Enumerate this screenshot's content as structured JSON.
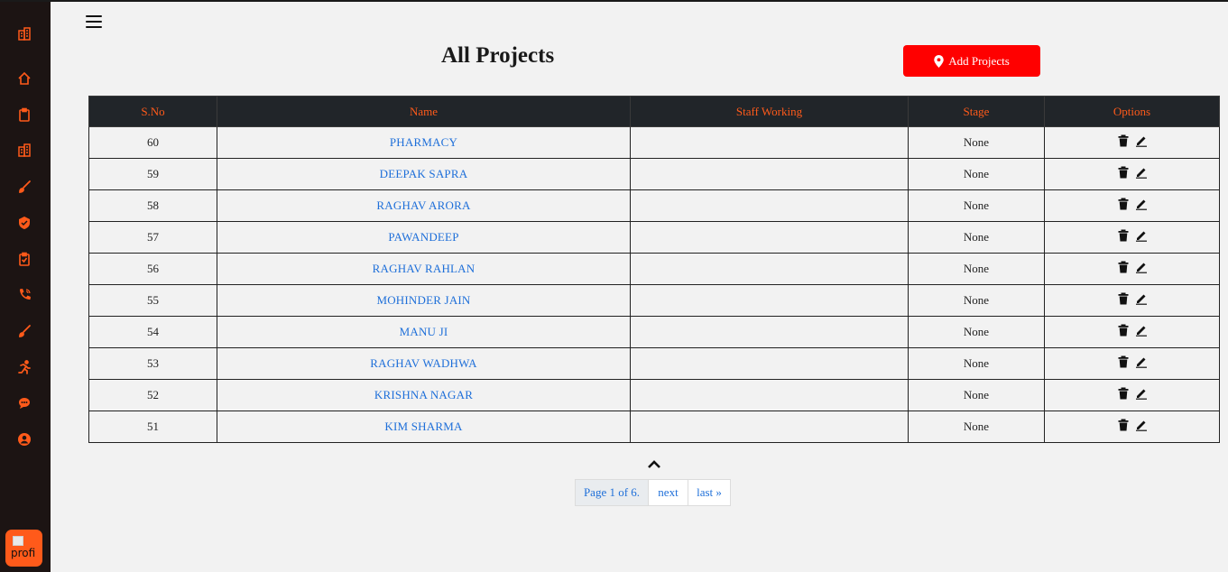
{
  "page": {
    "title": "All Projects"
  },
  "actions": {
    "add_label": "Add Projects"
  },
  "sidebar": {
    "icons": [
      "building-icon",
      "home-icon",
      "clipboard-icon",
      "building-icon",
      "brush-icon",
      "badge-icon",
      "clipboard-check-icon",
      "phone-icon",
      "brush-icon",
      "running-icon",
      "chat-icon",
      "user-icon"
    ],
    "accent": "#ff5a1a",
    "profile_alt": "profi"
  },
  "table": {
    "headers": [
      "S.No",
      "Name",
      "Staff Working",
      "Stage",
      "Options"
    ],
    "rows": [
      {
        "sno": "60",
        "name": "PHARMACY",
        "staff": "",
        "stage": "None"
      },
      {
        "sno": "59",
        "name": "DEEPAK SAPRA",
        "staff": "",
        "stage": "None"
      },
      {
        "sno": "58",
        "name": "RAGHAV ARORA",
        "staff": "",
        "stage": "None"
      },
      {
        "sno": "57",
        "name": "PAWANDEEP",
        "staff": "",
        "stage": "None"
      },
      {
        "sno": "56",
        "name": "RAGHAV RAHLAN",
        "staff": "",
        "stage": "None"
      },
      {
        "sno": "55",
        "name": "MOHINDER JAIN",
        "staff": "",
        "stage": "None"
      },
      {
        "sno": "54",
        "name": "MANU JI",
        "staff": "",
        "stage": "None"
      },
      {
        "sno": "53",
        "name": "RAGHAV WADHWA",
        "staff": "",
        "stage": "None"
      },
      {
        "sno": "52",
        "name": "KRISHNA NAGAR",
        "staff": "",
        "stage": "None"
      },
      {
        "sno": "51",
        "name": "KIM SHARMA",
        "staff": "",
        "stage": "None"
      }
    ]
  },
  "pagination": {
    "current": "Page 1 of 6.",
    "next": "next",
    "last": "last »"
  },
  "colors": {
    "add_button": "#ff0000",
    "header_bg": "#212529",
    "link": "#1e6fd9"
  }
}
